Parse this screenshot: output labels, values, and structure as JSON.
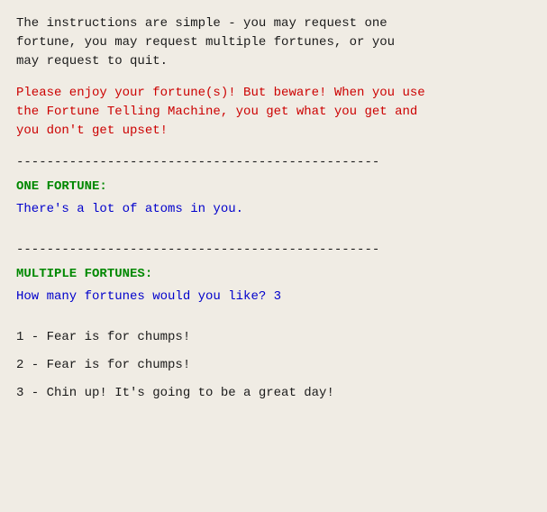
{
  "intro": {
    "line1": "The instructions are simple - you may request one",
    "line2": "fortune, you  may request multiple fortunes, or you",
    "line3": "may request to quit."
  },
  "enjoy": {
    "line1": "Please enjoy your fortune(s)! But beware! When you use",
    "line2": "the Fortune Telling Machine, you get what you get and",
    "line3": "you don't get upset!"
  },
  "divider": "------------------------------------------------",
  "one_fortune": {
    "header": "ONE FORTUNE:",
    "fortune": "There's a lot of atoms in you."
  },
  "multiple_fortunes": {
    "header": "MULTIPLE FORTUNES:",
    "prompt": "How many fortunes would you like? 3",
    "items": [
      "1 - Fear is for chumps!",
      "2 - Fear is for chumps!",
      "3 - Chin up! It's going to be a great day!"
    ]
  }
}
